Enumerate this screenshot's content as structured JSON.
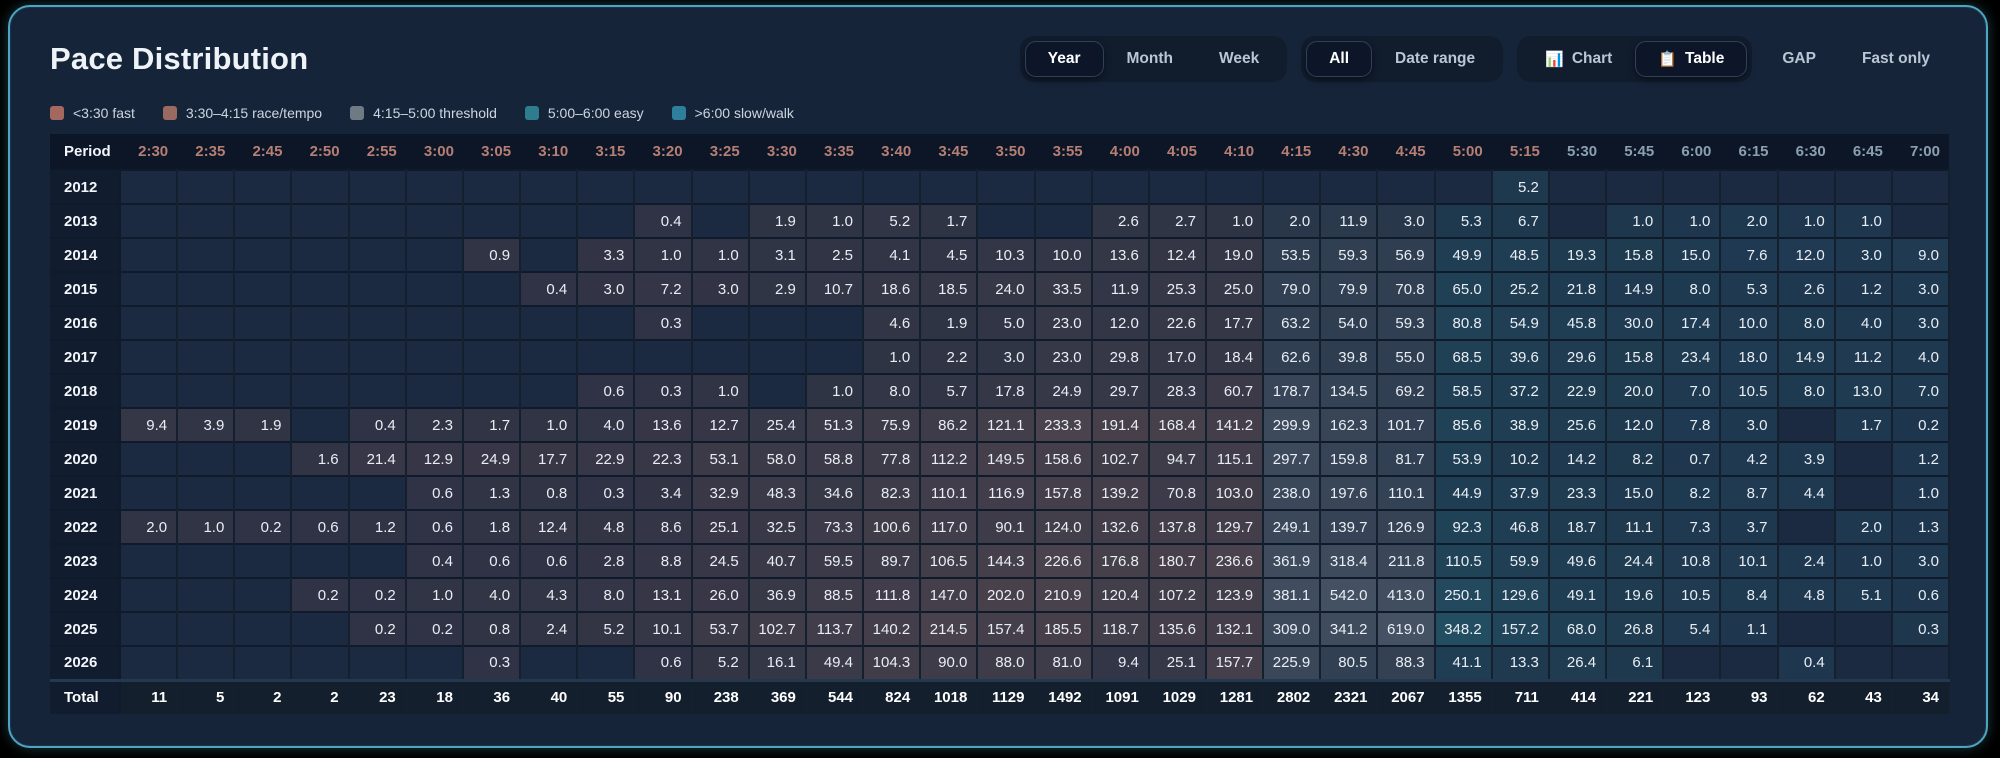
{
  "title": "Pace Distribution",
  "controls": {
    "period_group": {
      "options": [
        "Year",
        "Month",
        "Week"
      ],
      "selected": "Year"
    },
    "range_group": {
      "options": [
        "All",
        "Date range"
      ],
      "selected": "All"
    },
    "view_group": {
      "options": [
        {
          "icon": "📊",
          "icon_name": "chart-icon",
          "label": "Chart"
        },
        {
          "icon": "📋",
          "icon_name": "table-icon",
          "label": "Table"
        }
      ],
      "selected": "Table"
    },
    "gap_label": "GAP",
    "fast_only_label": "Fast only"
  },
  "legend": [
    {
      "zone": "fast",
      "label": "<3:30 fast",
      "color": "#a4685f"
    },
    {
      "zone": "tempo",
      "label": "3:30–4:15 race/tempo",
      "color": "#9a6a60"
    },
    {
      "zone": "threshold",
      "label": "4:15–5:00 threshold",
      "color": "#6f7a85"
    },
    {
      "zone": "easy",
      "label": "5:00–6:00 easy",
      "color": "#2e7d8f"
    },
    {
      "zone": "slow",
      "label": ">6:00 slow/walk",
      "color": "#2e7f9b"
    }
  ],
  "colors": {
    "header_warm": "#b67f75",
    "header_cool": "#8ba0af",
    "card_border": "#4da6c0",
    "cell_base": "#1b2a40"
  },
  "table": {
    "period_header": "Period",
    "total_label": "Total",
    "columns": [
      {
        "label": "2:30",
        "zone": "fast",
        "hdr": "warm"
      },
      {
        "label": "2:35",
        "zone": "fast",
        "hdr": "warm"
      },
      {
        "label": "2:45",
        "zone": "fast",
        "hdr": "warm"
      },
      {
        "label": "2:50",
        "zone": "fast",
        "hdr": "warm"
      },
      {
        "label": "2:55",
        "zone": "fast",
        "hdr": "warm"
      },
      {
        "label": "3:00",
        "zone": "fast",
        "hdr": "warm"
      },
      {
        "label": "3:05",
        "zone": "fast",
        "hdr": "warm"
      },
      {
        "label": "3:10",
        "zone": "fast",
        "hdr": "warm"
      },
      {
        "label": "3:15",
        "zone": "fast",
        "hdr": "warm"
      },
      {
        "label": "3:20",
        "zone": "fast",
        "hdr": "warm"
      },
      {
        "label": "3:25",
        "zone": "fast",
        "hdr": "warm"
      },
      {
        "label": "3:30",
        "zone": "tempo",
        "hdr": "warm"
      },
      {
        "label": "3:35",
        "zone": "tempo",
        "hdr": "warm"
      },
      {
        "label": "3:40",
        "zone": "tempo",
        "hdr": "warm"
      },
      {
        "label": "3:45",
        "zone": "tempo",
        "hdr": "warm"
      },
      {
        "label": "3:50",
        "zone": "tempo",
        "hdr": "warm"
      },
      {
        "label": "3:55",
        "zone": "tempo",
        "hdr": "warm"
      },
      {
        "label": "4:00",
        "zone": "tempo",
        "hdr": "warm"
      },
      {
        "label": "4:05",
        "zone": "tempo",
        "hdr": "warm"
      },
      {
        "label": "4:10",
        "zone": "tempo",
        "hdr": "warm"
      },
      {
        "label": "4:15",
        "zone": "threshold",
        "hdr": "warm"
      },
      {
        "label": "4:30",
        "zone": "threshold",
        "hdr": "warm"
      },
      {
        "label": "4:45",
        "zone": "threshold",
        "hdr": "warm"
      },
      {
        "label": "5:00",
        "zone": "easy",
        "hdr": "warm"
      },
      {
        "label": "5:15",
        "zone": "easy",
        "hdr": "warm"
      },
      {
        "label": "5:30",
        "zone": "easy",
        "hdr": "cool"
      },
      {
        "label": "5:45",
        "zone": "easy",
        "hdr": "cool"
      },
      {
        "label": "6:00",
        "zone": "slow",
        "hdr": "cool"
      },
      {
        "label": "6:15",
        "zone": "slow",
        "hdr": "cool"
      },
      {
        "label": "6:30",
        "zone": "slow",
        "hdr": "cool"
      },
      {
        "label": "6:45",
        "zone": "slow",
        "hdr": "cool"
      },
      {
        "label": "7:00",
        "zone": "slow",
        "hdr": "cool"
      }
    ],
    "rows": [
      {
        "label": "2012",
        "values": [
          null,
          null,
          null,
          null,
          null,
          null,
          null,
          null,
          null,
          null,
          null,
          null,
          null,
          null,
          null,
          null,
          null,
          null,
          null,
          null,
          null,
          null,
          null,
          null,
          "5.2",
          null,
          null,
          null,
          null,
          null,
          null,
          null
        ]
      },
      {
        "label": "2013",
        "values": [
          null,
          null,
          null,
          null,
          null,
          null,
          null,
          null,
          null,
          "0.4",
          null,
          "1.9",
          "1.0",
          "5.2",
          "1.7",
          null,
          null,
          "2.6",
          "2.7",
          "1.0",
          "2.0",
          "11.9",
          "3.0",
          "5.3",
          "6.7",
          null,
          "1.0",
          "1.0",
          "2.0",
          "1.0",
          "1.0",
          null
        ]
      },
      {
        "label": "2014",
        "values": [
          null,
          null,
          null,
          null,
          null,
          null,
          "0.9",
          null,
          "3.3",
          "1.0",
          "1.0",
          "3.1",
          "2.5",
          "4.1",
          "4.5",
          "10.3",
          "10.0",
          "13.6",
          "12.4",
          "19.0",
          "53.5",
          "59.3",
          "56.9",
          "49.9",
          "48.5",
          "19.3",
          "15.8",
          "15.0",
          "7.6",
          "12.0",
          "3.0",
          "9.0"
        ]
      },
      {
        "label": "2015",
        "values": [
          null,
          null,
          null,
          null,
          null,
          null,
          null,
          "0.4",
          "3.0",
          "7.2",
          "3.0",
          "2.9",
          "10.7",
          "18.6",
          "18.5",
          "24.0",
          "33.5",
          "11.9",
          "25.3",
          "25.0",
          "79.0",
          "79.9",
          "70.8",
          "65.0",
          "25.2",
          "21.8",
          "14.9",
          "8.0",
          "5.3",
          "2.6",
          "1.2",
          "3.0"
        ]
      },
      {
        "label": "2016",
        "values": [
          null,
          null,
          null,
          null,
          null,
          null,
          null,
          null,
          null,
          "0.3",
          null,
          null,
          null,
          "4.6",
          "1.9",
          "5.0",
          "23.0",
          "12.0",
          "22.6",
          "17.7",
          "63.2",
          "54.0",
          "59.3",
          "80.8",
          "54.9",
          "45.8",
          "30.0",
          "17.4",
          "10.0",
          "8.0",
          "4.0",
          "3.0"
        ]
      },
      {
        "label": "2017",
        "values": [
          null,
          null,
          null,
          null,
          null,
          null,
          null,
          null,
          null,
          null,
          null,
          null,
          null,
          "1.0",
          "2.2",
          "3.0",
          "23.0",
          "29.8",
          "17.0",
          "18.4",
          "62.6",
          "39.8",
          "55.0",
          "68.5",
          "39.6",
          "29.6",
          "15.8",
          "23.4",
          "18.0",
          "14.9",
          "11.2",
          "4.0"
        ]
      },
      {
        "label": "2018",
        "values": [
          null,
          null,
          null,
          null,
          null,
          null,
          null,
          null,
          "0.6",
          "0.3",
          "1.0",
          null,
          "1.0",
          "8.0",
          "5.7",
          "17.8",
          "24.9",
          "29.7",
          "28.3",
          "60.7",
          "178.7",
          "134.5",
          "69.2",
          "58.5",
          "37.2",
          "22.9",
          "20.0",
          "7.0",
          "10.5",
          "8.0",
          "13.0",
          "7.0"
        ]
      },
      {
        "label": "2019",
        "values": [
          "9.4",
          "3.9",
          "1.9",
          null,
          "0.4",
          "2.3",
          "1.7",
          "1.0",
          "4.0",
          "13.6",
          "12.7",
          "25.4",
          "51.3",
          "75.9",
          "86.2",
          "121.1",
          "233.3",
          "191.4",
          "168.4",
          "141.2",
          "299.9",
          "162.3",
          "101.7",
          "85.6",
          "38.9",
          "25.6",
          "12.0",
          "7.8",
          "3.0",
          null,
          "1.7",
          "0.2"
        ]
      },
      {
        "label": "2020",
        "values": [
          null,
          null,
          null,
          "1.6",
          "21.4",
          "12.9",
          "24.9",
          "17.7",
          "22.9",
          "22.3",
          "53.1",
          "58.0",
          "58.8",
          "77.8",
          "112.2",
          "149.5",
          "158.6",
          "102.7",
          "94.7",
          "115.1",
          "297.7",
          "159.8",
          "81.7",
          "53.9",
          "10.2",
          "14.2",
          "8.2",
          "0.7",
          "4.2",
          "3.9",
          null,
          "1.2"
        ]
      },
      {
        "label": "2021",
        "values": [
          null,
          null,
          null,
          null,
          null,
          "0.6",
          "1.3",
          "0.8",
          "0.3",
          "3.4",
          "32.9",
          "48.3",
          "34.6",
          "82.3",
          "110.1",
          "116.9",
          "157.8",
          "139.2",
          "70.8",
          "103.0",
          "238.0",
          "197.6",
          "110.1",
          "44.9",
          "37.9",
          "23.3",
          "15.0",
          "8.2",
          "8.7",
          "4.4",
          null,
          "1.0"
        ]
      },
      {
        "label": "2022",
        "values": [
          "2.0",
          "1.0",
          "0.2",
          "0.6",
          "1.2",
          "0.6",
          "1.8",
          "12.4",
          "4.8",
          "8.6",
          "25.1",
          "32.5",
          "73.3",
          "100.6",
          "117.0",
          "90.1",
          "124.0",
          "132.6",
          "137.8",
          "129.7",
          "249.1",
          "139.7",
          "126.9",
          "92.3",
          "46.8",
          "18.7",
          "11.1",
          "7.3",
          "3.7",
          null,
          "2.0",
          "1.3"
        ]
      },
      {
        "label": "2023",
        "values": [
          null,
          null,
          null,
          null,
          null,
          "0.4",
          "0.6",
          "0.6",
          "2.8",
          "8.8",
          "24.5",
          "40.7",
          "59.5",
          "89.7",
          "106.5",
          "144.3",
          "226.6",
          "176.8",
          "180.7",
          "236.6",
          "361.9",
          "318.4",
          "211.8",
          "110.5",
          "59.9",
          "49.6",
          "24.4",
          "10.8",
          "10.1",
          "2.4",
          "1.0",
          "3.0"
        ]
      },
      {
        "label": "2024",
        "values": [
          null,
          null,
          null,
          "0.2",
          "0.2",
          "1.0",
          "4.0",
          "4.3",
          "8.0",
          "13.1",
          "26.0",
          "36.9",
          "88.5",
          "111.8",
          "147.0",
          "202.0",
          "210.9",
          "120.4",
          "107.2",
          "123.9",
          "381.1",
          "542.0",
          "413.0",
          "250.1",
          "129.6",
          "49.1",
          "19.6",
          "10.5",
          "8.4",
          "4.8",
          "5.1",
          "0.6"
        ]
      },
      {
        "label": "2025",
        "values": [
          null,
          null,
          null,
          null,
          "0.2",
          "0.2",
          "0.8",
          "2.4",
          "5.2",
          "10.1",
          "53.7",
          "102.7",
          "113.7",
          "140.2",
          "214.5",
          "157.4",
          "185.5",
          "118.7",
          "135.6",
          "132.1",
          "309.0",
          "341.2",
          "619.0",
          "348.2",
          "157.2",
          "68.0",
          "26.8",
          "5.4",
          "1.1",
          null,
          null,
          "0.3"
        ]
      },
      {
        "label": "2026",
        "values": [
          null,
          null,
          null,
          null,
          null,
          null,
          "0.3",
          null,
          null,
          "0.6",
          "5.2",
          "16.1",
          "49.4",
          "104.3",
          "90.0",
          "88.0",
          "81.0",
          "9.4",
          "25.1",
          "157.7",
          "225.9",
          "80.5",
          "88.3",
          "41.1",
          "13.3",
          "26.4",
          "6.1",
          null,
          null,
          "0.4",
          null,
          null
        ]
      }
    ],
    "totals": [
      "11",
      "5",
      "2",
      "2",
      "23",
      "18",
      "36",
      "40",
      "55",
      "90",
      "238",
      "369",
      "544",
      "824",
      "1018",
      "1129",
      "1492",
      "1091",
      "1029",
      "1281",
      "2802",
      "2321",
      "2067",
      "1355",
      "711",
      "414",
      "221",
      "123",
      "93",
      "62",
      "43",
      "34"
    ]
  }
}
